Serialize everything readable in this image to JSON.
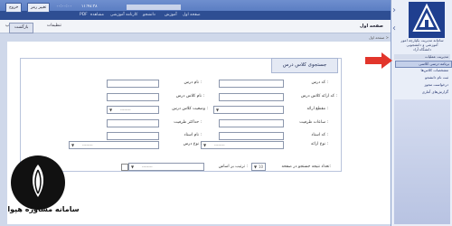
{
  "topbar": {
    "items": [
      "۱۱:۴۸:۳۸",
      "۰۰:۰۰:۰۰",
      "تغییر رمز",
      "خروج"
    ],
    "menu": [
      "صفحه اول",
      "آموزش",
      "دانشجو",
      "کارنامه آموزشی",
      "مشاهده",
      "PDF"
    ],
    "save_label": "پیش صفحه چاپ",
    "settings_label": "تنظیمات"
  },
  "header": {
    "page_title": "صفحه اول",
    "back_label": "بازگشت",
    "breadcrumb": "صفحه اول >"
  },
  "sidebar": {
    "institution": [
      "سامانه مدیریت یکپارچه امور",
      "آموزشی و دانشجویی",
      "دانشگاه آزاد"
    ],
    "section_head": "مدیریت عملیات",
    "items": [
      {
        "label": "برنامه درسی کلاسی",
        "active": true
      },
      {
        "label": "مشخصات کلاس‌ها",
        "active": false
      },
      {
        "label": "ثبت نام دانشجو",
        "active": false
      },
      {
        "label": "درخواست مجوز",
        "active": false
      },
      {
        "label": "گزارش‌های آماری",
        "active": false
      }
    ]
  },
  "search": {
    "legend": "جستجوی کلاس درس",
    "right_fields": [
      {
        "label": "کد درس :",
        "type": "input",
        "value": ""
      },
      {
        "label": "کد ارائه کلاس درس :",
        "type": "input",
        "value": ""
      },
      {
        "label": "مقطع ارائه :",
        "type": "select",
        "value": ""
      },
      {
        "label": "ساعات ظرفیت :",
        "type": "input",
        "value": ""
      },
      {
        "label": "کد استاد :",
        "type": "input",
        "value": ""
      },
      {
        "label": "نوع ارائه :",
        "type": "select",
        "value": "--------"
      }
    ],
    "left_fields": [
      {
        "label": "نام درس :",
        "type": "input",
        "value": ""
      },
      {
        "label": "نام کلاس درس :",
        "type": "input",
        "value": ""
      },
      {
        "label": "وضعیت کلاس درس :",
        "type": "select",
        "value": "--------"
      },
      {
        "label": "حداکثر ظرفیت :",
        "type": "input",
        "value": ""
      },
      {
        "label": "نام استاد :",
        "type": "input",
        "value": ""
      },
      {
        "label": "نوع درس :",
        "type": "select",
        "value": "--------"
      }
    ],
    "bottom_label": "تعداد نتیجه جستجو در صفحه:",
    "bottom_count": "10",
    "sort_label": "ترتیب بر اساس :",
    "sort_value": "--------"
  },
  "brand": {
    "text": "سامانه مشاوره هپوا"
  },
  "colors": {
    "accent": "#2e4e93",
    "arrow": "#e2352b"
  }
}
